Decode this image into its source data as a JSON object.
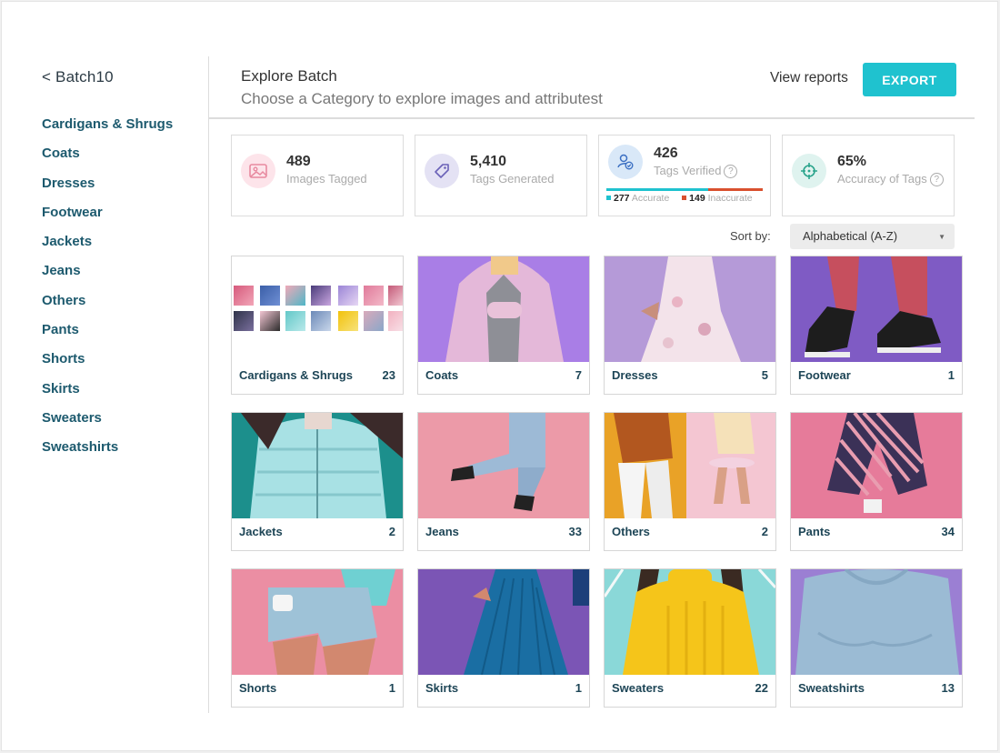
{
  "sidebar": {
    "back_label": "< Batch10",
    "items": [
      "Cardigans & Shrugs",
      "Coats",
      "Dresses",
      "Footwear",
      "Jackets",
      "Jeans",
      "Others",
      "Pants",
      "Shorts",
      "Skirts",
      "Sweaters",
      "Sweatshirts"
    ]
  },
  "header": {
    "title": "Explore Batch",
    "subtitle": "Choose a Category to explore images and attributest",
    "view_reports": "View reports",
    "export_label": "EXPORT"
  },
  "stats": {
    "images": {
      "value": "489",
      "label": "Images Tagged",
      "icon": "image-icon",
      "color": "#fde4ea"
    },
    "tags": {
      "value": "5,410",
      "label": "Tags Generated",
      "icon": "tag-icon",
      "color": "#e4e2f4"
    },
    "verified": {
      "value": "426",
      "label": "Tags Verified",
      "help": "?",
      "icon": "verified-icon",
      "color": "#d9e8f8",
      "accurate_count": "277",
      "accurate_label": "Accurate",
      "inaccurate_count": "149",
      "inaccurate_label": "Inaccurate",
      "accurate_fraction": 0.65
    },
    "accuracy": {
      "value": "65%",
      "label": "Accuracy of Tags",
      "help": "?",
      "icon": "target-icon",
      "color": "#dff3ef"
    }
  },
  "sort": {
    "label": "Sort by:",
    "selected": "Alphabetical (A-Z)"
  },
  "categories": [
    {
      "name": "Cardigans & Shrugs",
      "count": "23"
    },
    {
      "name": "Coats",
      "count": "7"
    },
    {
      "name": "Dresses",
      "count": "5"
    },
    {
      "name": "Footwear",
      "count": "1"
    },
    {
      "name": "Jackets",
      "count": "2"
    },
    {
      "name": "Jeans",
      "count": "33"
    },
    {
      "name": "Others",
      "count": "2"
    },
    {
      "name": "Pants",
      "count": "34"
    },
    {
      "name": "Shorts",
      "count": "1"
    },
    {
      "name": "Skirts",
      "count": "1"
    },
    {
      "name": "Sweaters",
      "count": "22"
    },
    {
      "name": "Sweatshirts",
      "count": "13"
    }
  ],
  "colors": {
    "accent": "#1fc2cf",
    "nav_text": "#1d5a6e",
    "inaccurate": "#d9502e"
  }
}
